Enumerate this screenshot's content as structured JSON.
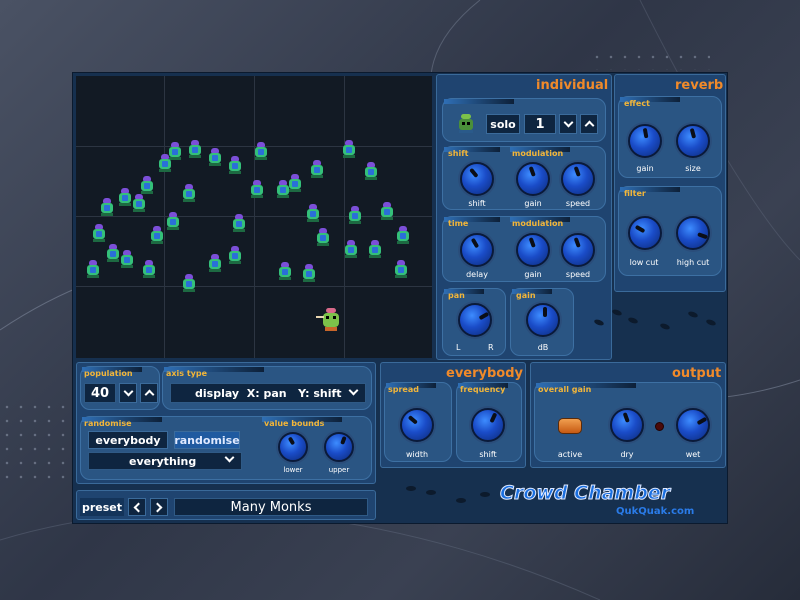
{
  "plugin": {
    "name": "Crowd Chamber",
    "vendor": "QukQuak.com"
  },
  "individual": {
    "title": "individual",
    "solo_label": "solo",
    "voice_number": "1",
    "shift": {
      "section": "shift",
      "knob_label": "shift"
    },
    "modulation1": {
      "section": "modulation",
      "gain": "gain",
      "speed": "speed"
    },
    "time": {
      "section": "time",
      "knob_label": "delay"
    },
    "modulation2": {
      "section": "modulation",
      "gain": "gain",
      "speed": "speed"
    },
    "pan": {
      "section": "pan",
      "left": "L",
      "right": "R"
    },
    "gain": {
      "section": "gain",
      "unit": "dB"
    }
  },
  "reverb": {
    "title": "reverb",
    "effect": {
      "section": "effect",
      "gain": "gain",
      "size": "size"
    },
    "filter": {
      "section": "filter",
      "low_cut": "low cut",
      "high_cut": "high cut"
    }
  },
  "population": {
    "label": "population",
    "value": "40"
  },
  "axis_type": {
    "label": "axis type",
    "value": "display  X: pan   Y: shift"
  },
  "randomise": {
    "label": "randomise",
    "target": "everybody",
    "button": "randomise",
    "mode": "everything"
  },
  "value_bounds": {
    "label": "value bounds",
    "lower": "lower",
    "upper": "upper"
  },
  "everybody": {
    "title": "everybody",
    "spread": {
      "section": "spread",
      "knob_label": "width"
    },
    "frequency": {
      "section": "frequency",
      "knob_label": "shift"
    }
  },
  "output": {
    "title": "output",
    "section": "overall gain",
    "active": "active",
    "dry": "dry",
    "wet": "wet"
  },
  "preset": {
    "label": "preset",
    "name": "Many Monks"
  },
  "icons": [
    "chevron-down-icon",
    "chevron-up-icon",
    "chevron-left-icon",
    "chevron-right-icon",
    "monk-icon",
    "footprints-icon"
  ],
  "colors": {
    "accent_orange": "#f08a2a",
    "label_yellow": "#f2b63a",
    "panel_blue": "#1f4470",
    "knob_blue": "#1a4cc8",
    "plot_bg": "#121a24"
  }
}
